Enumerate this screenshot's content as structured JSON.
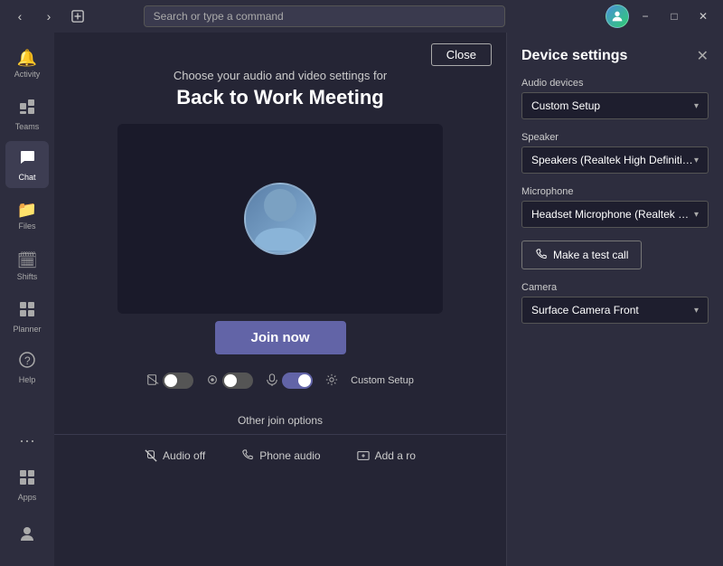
{
  "titlebar": {
    "search_placeholder": "Search or type a command",
    "minimize_label": "−",
    "maximize_label": "□",
    "close_label": "✕"
  },
  "sidebar": {
    "items": [
      {
        "id": "activity",
        "label": "Activity",
        "icon": "🔔"
      },
      {
        "id": "teams",
        "label": "Teams",
        "icon": "⊞"
      },
      {
        "id": "chat",
        "label": "Chat",
        "icon": "💬"
      },
      {
        "id": "files",
        "label": "Files",
        "icon": "📁"
      },
      {
        "id": "shifts",
        "label": "Shifts",
        "icon": "🗓"
      },
      {
        "id": "planner",
        "label": "Planner",
        "icon": "📋"
      },
      {
        "id": "help",
        "label": "Help",
        "icon": "❓"
      }
    ],
    "apps_label": "Apps",
    "more_label": "..."
  },
  "meeting": {
    "close_label": "Close",
    "subtitle": "Choose your audio and video settings for",
    "title": "Back to Work Meeting",
    "join_label": "Join now",
    "other_join_options": "Other join options",
    "audio_off_label": "Audio off",
    "phone_audio_label": "Phone audio",
    "add_room_label": "Add a ro",
    "custom_setup_label": "Custom Setup"
  },
  "device_settings": {
    "title": "Device settings",
    "audio_devices_label": "Audio devices",
    "audio_devices_value": "Custom Setup",
    "speaker_label": "Speaker",
    "speaker_value": "Speakers (Realtek High Definition Au...",
    "microphone_label": "Microphone",
    "microphone_value": "Headset Microphone (Realtek High D...",
    "make_test_call_label": "Make a test call",
    "camera_label": "Camera",
    "camera_value": "Surface Camera Front"
  }
}
